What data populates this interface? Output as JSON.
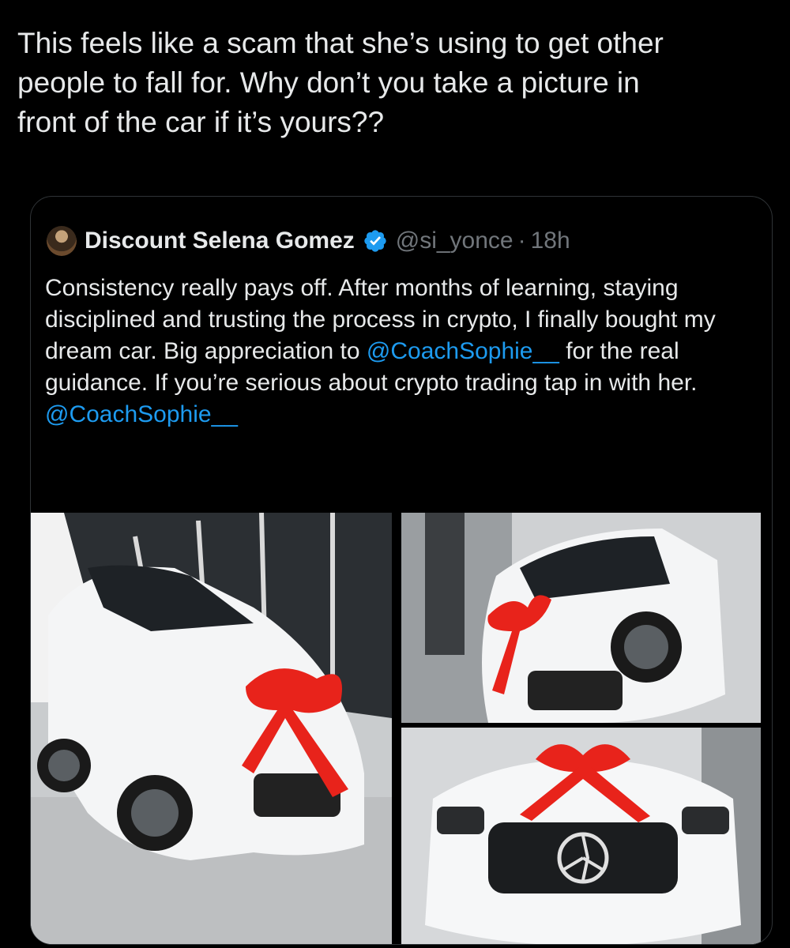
{
  "tweet": {
    "text": "This feels like a scam that she’s using to get other\npeople to fall for. Why don’t you take a picture in\nfront of the car if it’s yours??"
  },
  "quoted_tweet": {
    "display_name": "Discount Selena Gomez",
    "handle": "@si_yonce",
    "separator": "·",
    "time": "18h",
    "body": {
      "part1": "Consistency really pays off. After months of learning, staying disciplined and trusting the process in crypto, I finally bought my dream car. Big appreciation to ",
      "mention1": "@CoachSophie__",
      "part2": " for the real guidance. If you’re serious about crypto trading tap in with her. ",
      "mention2": "@CoachSophie__"
    },
    "media": [
      {
        "description_icon": "car-photo"
      },
      {
        "description_icon": "car-photo"
      },
      {
        "description_icon": "car-photo"
      }
    ]
  },
  "colors": {
    "background": "#000000",
    "text": "#e7e9ea",
    "secondary": "#71767b",
    "accent": "#1d9bf0",
    "border": "#2f3336"
  }
}
